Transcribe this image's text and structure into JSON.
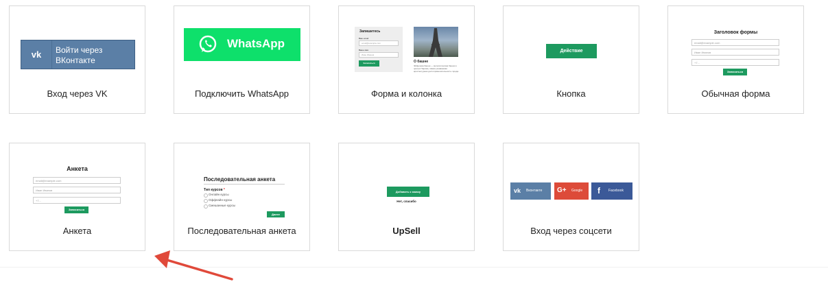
{
  "cards": [
    {
      "label": "Вход через VK",
      "vk_text_line1": "Войти через",
      "vk_text_line2": "ВКонтакте"
    },
    {
      "label": "Подключить WhatsApp",
      "wa_text": "WhatsApp"
    },
    {
      "label": "Форма и колонка",
      "form_title": "Запишитесь",
      "field1_label": "Ваш email",
      "field1_placeholder": "email@example.com",
      "field2_label": "Ваше имя",
      "field2_placeholder": "Иван Иванов",
      "button": "Записаться",
      "about_title": "О башне",
      "about_text": "Эйфелева башня — металлическая башня в центре Парижа, самая узнаваемая архитектурная достопримечательность города."
    },
    {
      "label": "Кнопка",
      "button": "Действие"
    },
    {
      "label": "Обычная форма",
      "form_title": "Заголовок формы",
      "field1": "email@example.com",
      "field2": "Иван Иванов",
      "field3": "+7...",
      "button": "Записаться"
    },
    {
      "label": "Анкета",
      "form_title": "Анкета",
      "field1": "email@example.com",
      "field2": "Иван Иванов",
      "field3": "+7...",
      "button": "Записаться"
    },
    {
      "label": "Последовательная анкета",
      "form_title": "Последовательная анкета",
      "question": "Тип курсов",
      "options": [
        "Онлайн курсы",
        "Оффлайн курсы",
        "Смешанные курсы"
      ],
      "button": "Далее"
    },
    {
      "label": "UpSell",
      "button": "Добавить к заказу",
      "link": "Нет, спасибо"
    },
    {
      "label": "Вход через соцсети",
      "vk": "Вконтакте",
      "google": "Google",
      "facebook": "Facebook"
    }
  ],
  "colors": {
    "vk": "#5b7fa6",
    "whatsapp": "#0ee06b",
    "green": "#1d9a5f",
    "google": "#dd4b39",
    "facebook": "#3b5998",
    "arrow": "#e0493a"
  }
}
